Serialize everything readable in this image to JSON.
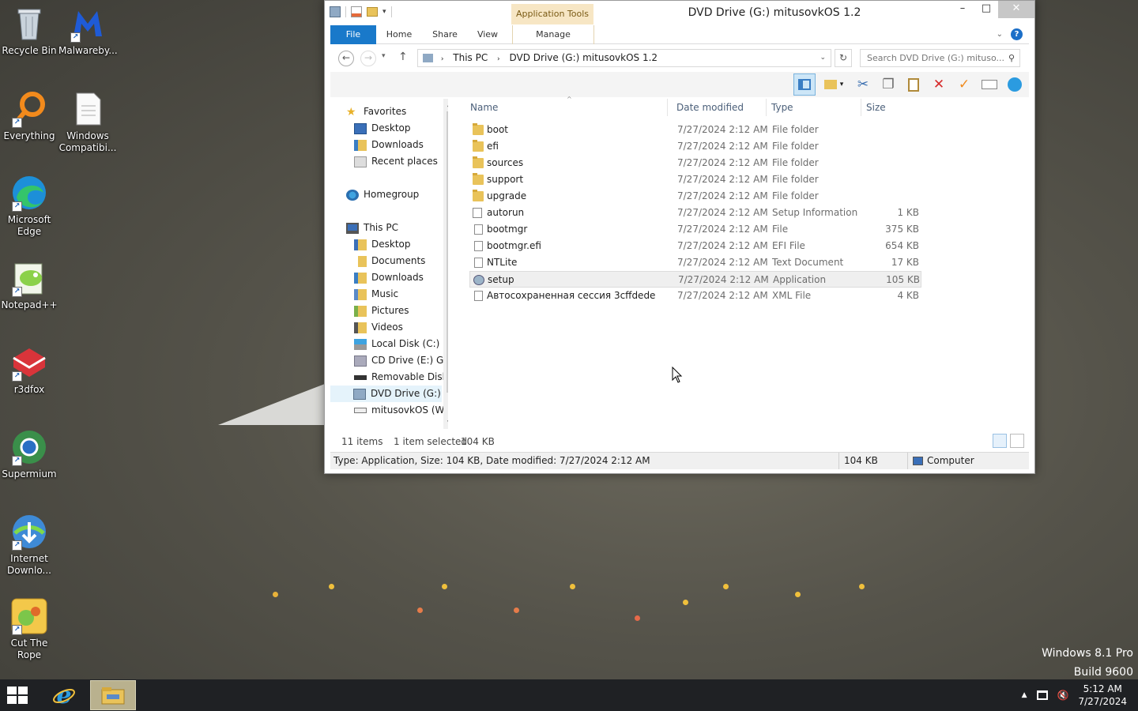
{
  "desktop": {
    "icons": [
      {
        "label": "Recycle Bin"
      },
      {
        "label": "Malwareby..."
      },
      {
        "label": "Everything"
      },
      {
        "label": "Windows Compatibi..."
      },
      {
        "label": "Microsoft Edge"
      },
      {
        "label": "Notepad++"
      },
      {
        "label": "r3dfox"
      },
      {
        "label": "Supermium"
      },
      {
        "label": "Internet Downlo..."
      },
      {
        "label": "Cut The Rope"
      }
    ],
    "watermark": {
      "line1": "Windows 8.1 Pro",
      "line2": "Build 9600"
    }
  },
  "window": {
    "title": "DVD Drive (G:) mitusovkOS 1.2",
    "context_tab": "Application Tools",
    "tabs": {
      "file": "File",
      "home": "Home",
      "share": "Share",
      "view": "View",
      "manage": "Manage"
    },
    "address": {
      "root": "This PC",
      "current": "DVD Drive (G:) mitusovkOS 1.2"
    },
    "search_placeholder": "Search DVD Drive (G:) mituso...",
    "nav": {
      "favorites": "Favorites",
      "fav_desktop": "Desktop",
      "fav_downloads": "Downloads",
      "fav_recent": "Recent places",
      "homegroup": "Homegroup",
      "thispc": "This PC",
      "pc_desktop": "Desktop",
      "pc_documents": "Documents",
      "pc_downloads": "Downloads",
      "pc_music": "Music",
      "pc_pictures": "Pictures",
      "pc_videos": "Videos",
      "local_disk": "Local Disk (C:)",
      "cd_drive": "CD Drive (E:) GPa",
      "removable": "Removable Disk (",
      "dvd_drive": "DVD Drive (G:) m",
      "mitusovkos": "mitusovkOS (W:)"
    },
    "columns": {
      "name": "Name",
      "date": "Date modified",
      "type": "Type",
      "size": "Size"
    },
    "files": [
      {
        "name": "boot",
        "date": "7/27/2024 2:12 AM",
        "type": "File folder",
        "size": ""
      },
      {
        "name": "efi",
        "date": "7/27/2024 2:12 AM",
        "type": "File folder",
        "size": ""
      },
      {
        "name": "sources",
        "date": "7/27/2024 2:12 AM",
        "type": "File folder",
        "size": ""
      },
      {
        "name": "support",
        "date": "7/27/2024 2:12 AM",
        "type": "File folder",
        "size": ""
      },
      {
        "name": "upgrade",
        "date": "7/27/2024 2:12 AM",
        "type": "File folder",
        "size": ""
      },
      {
        "name": "autorun",
        "date": "7/27/2024 2:12 AM",
        "type": "Setup Information",
        "size": "1 KB"
      },
      {
        "name": "bootmgr",
        "date": "7/27/2024 2:12 AM",
        "type": "File",
        "size": "375 KB"
      },
      {
        "name": "bootmgr.efi",
        "date": "7/27/2024 2:12 AM",
        "type": "EFI File",
        "size": "654 KB"
      },
      {
        "name": "NTLite",
        "date": "7/27/2024 2:12 AM",
        "type": "Text Document",
        "size": "17 KB"
      },
      {
        "name": "setup",
        "date": "7/27/2024 2:12 AM",
        "type": "Application",
        "size": "105 KB"
      },
      {
        "name": "Автосохраненная сессия 3cffdede",
        "date": "7/27/2024 2:12 AM",
        "type": "XML File",
        "size": "4 KB"
      }
    ],
    "status": {
      "item_count": "11 items",
      "selected": "1 item selected",
      "selected_size": "104 KB",
      "details": "Type: Application, Size: 104 KB, Date modified: 7/27/2024 2:12 AM",
      "size": "104 KB",
      "location": "Computer"
    }
  },
  "taskbar": {
    "time": "5:12 AM",
    "date": "7/27/2024"
  },
  "colors": {
    "accent": "#1979ca",
    "context_tab": "#f7e6c4",
    "taskbar": "#1f2124"
  }
}
